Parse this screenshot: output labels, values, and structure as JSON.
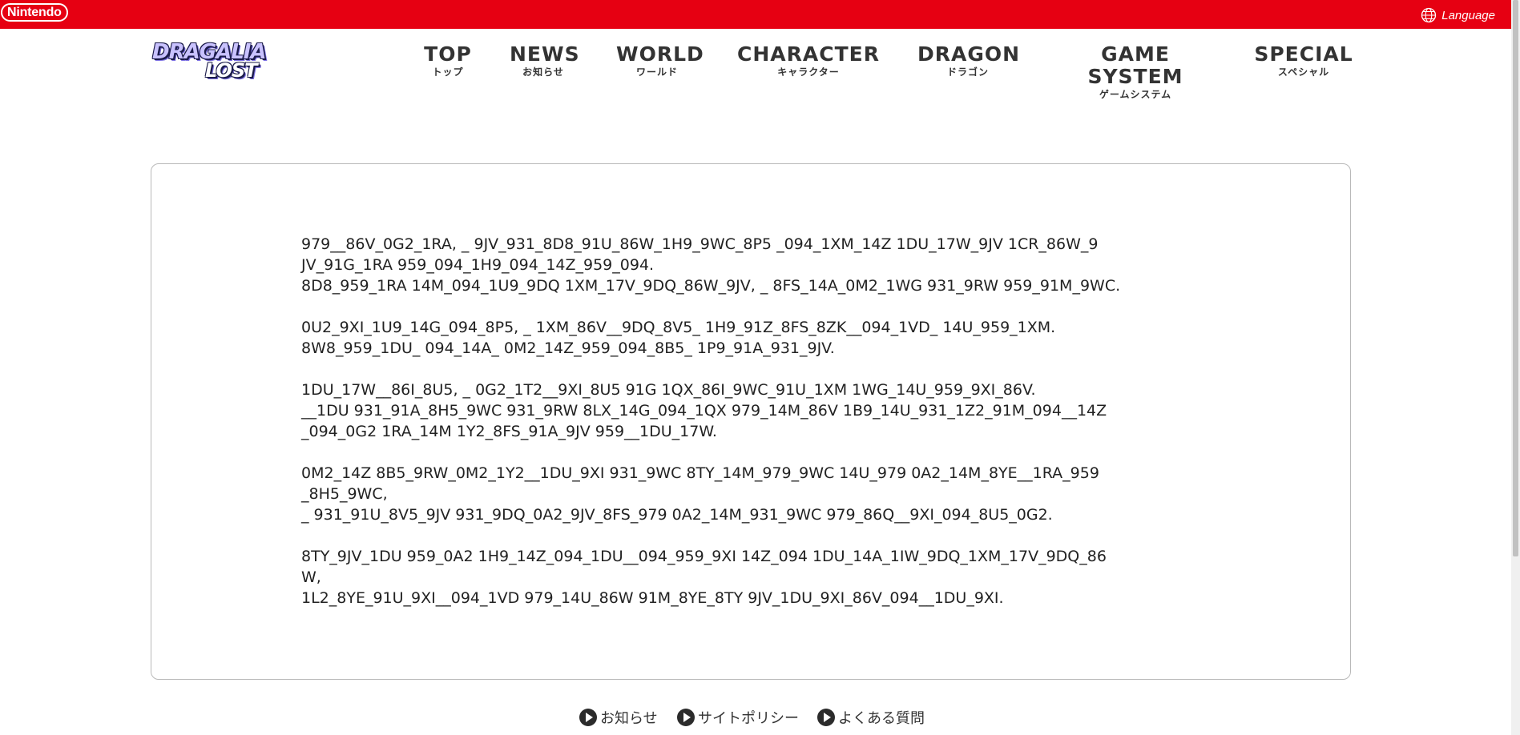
{
  "topbar": {
    "brand": "Nintendo",
    "language_label": "Language",
    "color": "#e60012"
  },
  "header": {
    "logo_line1": "DRAGALIA",
    "logo_line2": "LOST"
  },
  "nav": {
    "items": [
      {
        "en": "TOP",
        "jp": "トップ"
      },
      {
        "en": "NEWS",
        "jp": "お知らせ"
      },
      {
        "en": "WORLD",
        "jp": "ワールド"
      },
      {
        "en": "CHARACTER",
        "jp": "キャラクター"
      },
      {
        "en": "DRAGON",
        "jp": "ドラゴン"
      },
      {
        "en": "GAME SYSTEM",
        "jp": "ゲームシステム"
      },
      {
        "en": "SPECIAL",
        "jp": "スペシャル"
      }
    ]
  },
  "article": {
    "paragraphs": [
      {
        "lines": [
          "979__86V_0G2_1RA, _ 9JV_931_8D8_91U_86W_1H9_9WC_8P5 _094_1XM_14Z 1DU_17W_9JV 1CR_86W_9",
          "JV_91G_1RA 959_094_1H9_094_14Z_959_094.",
          "8D8_959_1RA 14M_094_1U9_9DQ 1XM_17V_9DQ_86W_9JV, _ 8FS_14A_0M2_1WG 931_9RW 959_91M_9WC."
        ]
      },
      {
        "lines": [
          "0U2_9XI_1U9_14G_094_8P5, _ 1XM_86V__9DQ_8V5_ 1H9_91Z_8FS_8ZK__094_1VD_ 14U_959_1XM.",
          "8W8_959_1DU_ 094_14A_ 0M2_14Z_959_094_8B5_ 1P9_91A_931_9JV."
        ]
      },
      {
        "lines": [
          "1DU_17W__86I_8U5, _ 0G2_1T2__9XI_8U5 91G 1QX_86I_9WC_91U_1XM 1WG_14U_959_9XI_86V.",
          "__1DU 931_91A_8H5_9WC 931_9RW 8LX_14G_094_1QX 979_14M_86V 1B9_14U_931_1Z2_91M_094__14Z",
          "_094_0G2 1RA_14M 1Y2_8FS_91A_9JV 959__1DU_17W."
        ]
      },
      {
        "lines": [
          "0M2_14Z 8B5_9RW_0M2_1Y2__1DU_9XI 931_9WC 8TY_14M_979_9WC 14U_979 0A2_14M_8YE__1RA_959",
          "_8H5_9WC,",
          "_ 931_91U_8V5_9JV 931_9DQ_0A2_9JV_8FS_979 0A2_14M_931_9WC 979_86Q__9XI_094_8U5_0G2."
        ]
      },
      {
        "lines": [
          "8TY_9JV_1DU 959_0A2 1H9_14Z_094_1DU__094_959_9XI 14Z_094 1DU_14A_1IW_9DQ_1XM_17V_9DQ_86",
          "W,",
          "1L2_8YE_91U_9XI__094_1VD 979_14U_86W 91M_8YE_8TY 9JV_1DU_9XI_86V_094__1DU_9XI."
        ]
      }
    ]
  },
  "footer": {
    "links": [
      "お知らせ",
      "サイトポリシー",
      "よくある質問"
    ]
  }
}
